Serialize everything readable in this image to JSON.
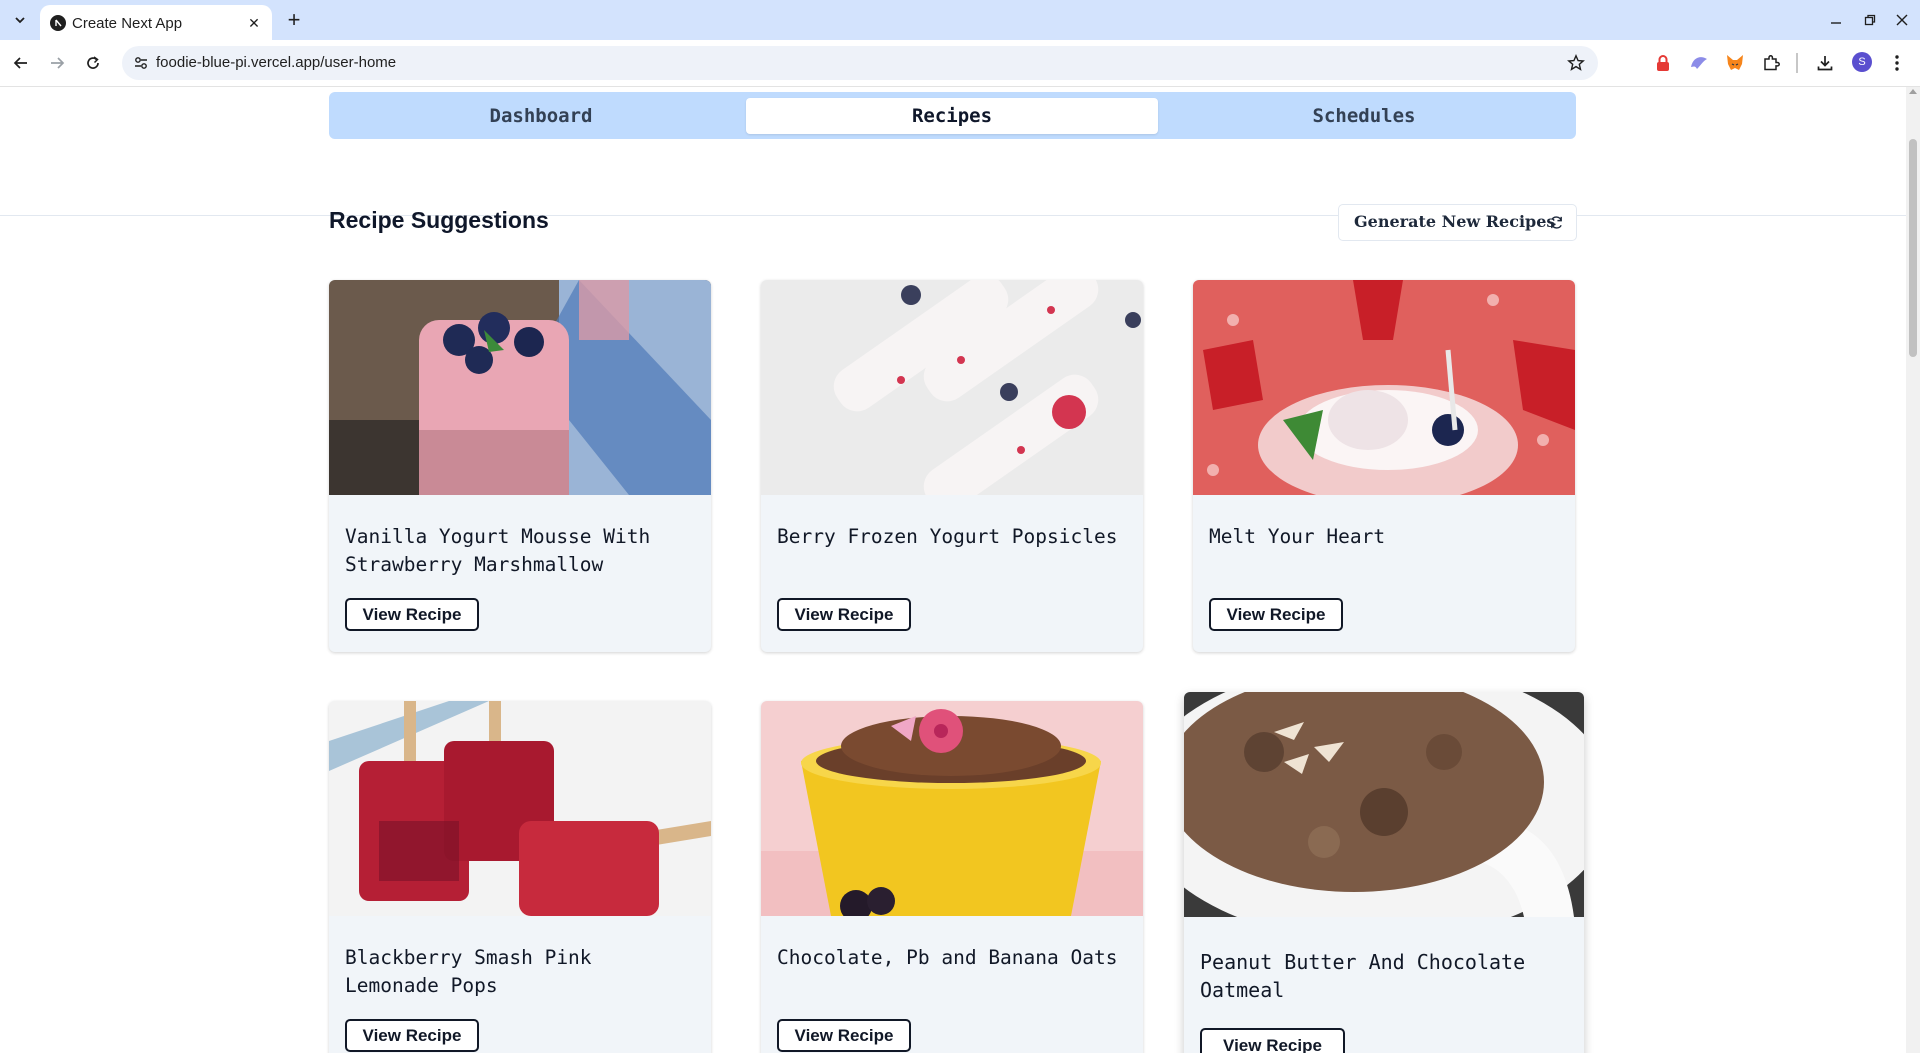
{
  "browser": {
    "tab_title": "Create Next App",
    "url": "foodie-blue-pi.vercel.app/user-home",
    "icons": [
      "tab-list-icon",
      "close-icon",
      "plus-icon",
      "minimize-icon",
      "restore-icon",
      "window-close-icon",
      "back-icon",
      "forward-icon",
      "reload-icon",
      "site-info-icon",
      "star-icon",
      "extension-icons",
      "puzzle-icon",
      "download-icon",
      "more-icon"
    ],
    "avatar_initial": "S"
  },
  "nav_tabs": [
    {
      "label": "Dashboard",
      "active": false
    },
    {
      "label": "Recipes",
      "active": true
    },
    {
      "label": "Schedules",
      "active": false
    }
  ],
  "section": {
    "title": "Recipe Suggestions",
    "generate_label": "Generate New Recipes"
  },
  "recipes": [
    {
      "title": "Vanilla Yogurt Mousse With Strawberry Marshmallow",
      "button": "View Recipe"
    },
    {
      "title": "Berry Frozen Yogurt Popsicles",
      "button": "View Recipe"
    },
    {
      "title": "Melt Your Heart",
      "button": "View Recipe"
    },
    {
      "title": "Blackberry Smash Pink Lemonade Pops",
      "button": "View Recipe"
    },
    {
      "title": "Chocolate, Pb and Banana Oats",
      "button": "View Recipe"
    },
    {
      "title": "Peanut Butter And Chocolate Oatmeal",
      "button": "View Recipe"
    }
  ],
  "colors": {
    "tab_bar": "#d3e3fd",
    "nav_tabs_bg": "#bfdbfe",
    "card_bg": "#f1f5f9"
  }
}
